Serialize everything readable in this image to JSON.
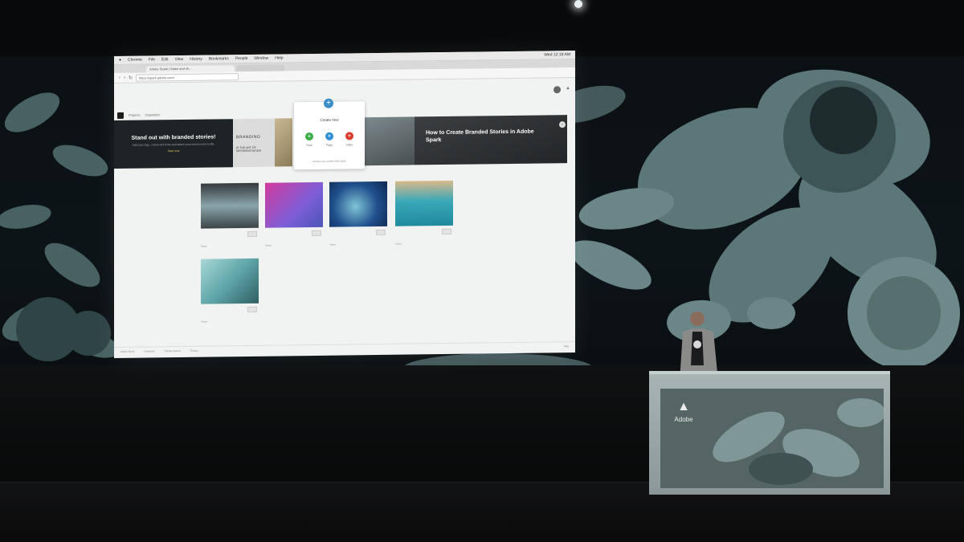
{
  "scene": {
    "podium_brand_text": "Adobe"
  },
  "screen": {
    "mac_menubar": {
      "items": [
        "Chrome",
        "File",
        "Edit",
        "View",
        "History",
        "Bookmarks",
        "People",
        "Window",
        "Help"
      ],
      "right_text": "Wed 12:18 AM"
    },
    "browser": {
      "tab_active_title": "Adobe Spark | Make and sh...",
      "tab_inactive_title": "",
      "url": "https://spark.adobe.com/"
    },
    "app": {
      "tabs": [
        "Projects",
        "Inspiration"
      ],
      "signin_text": "Upgrade"
    },
    "banner": {
      "card1_heading": "Stand out with branded stories!",
      "card1_body": "Add your logo, colors and fonts and watch your brand come to life.",
      "card1_cta": "Start now",
      "card2_line1": "BRANDING",
      "card2_line2": "IS THE ART OF DIFFERENTIATION",
      "card3_heading": "How to Create Branded Stories in Adobe Spark"
    },
    "create_popover": {
      "title": "Create new",
      "options": [
        {
          "label": "Post",
          "color": "#3cae48"
        },
        {
          "label": "Page",
          "color": "#2d8fd5"
        },
        {
          "label": "Video",
          "color": "#d93a2e"
        }
      ],
      "footer": "Design your content with Spark"
    },
    "projects": [
      {
        "title": "",
        "meta": "Share"
      },
      {
        "title": "",
        "meta": "Share"
      },
      {
        "title": "",
        "meta": "Share"
      },
      {
        "title": "",
        "meta": "Share"
      },
      {
        "title": "",
        "meta": "Share"
      }
    ],
    "status_bar": {
      "links": [
        "Adobe Spark",
        "Feedback",
        "Getting Started",
        "Privacy"
      ],
      "right": "Blog"
    }
  },
  "colors": {
    "flower": "#5b7779",
    "flower_dark": "#34494b",
    "podium": "#8c9898"
  },
  "icons": [
    "user-icon",
    "adobe-icon",
    "plus-icon",
    "arrow-right-icon",
    "search-icon"
  ]
}
